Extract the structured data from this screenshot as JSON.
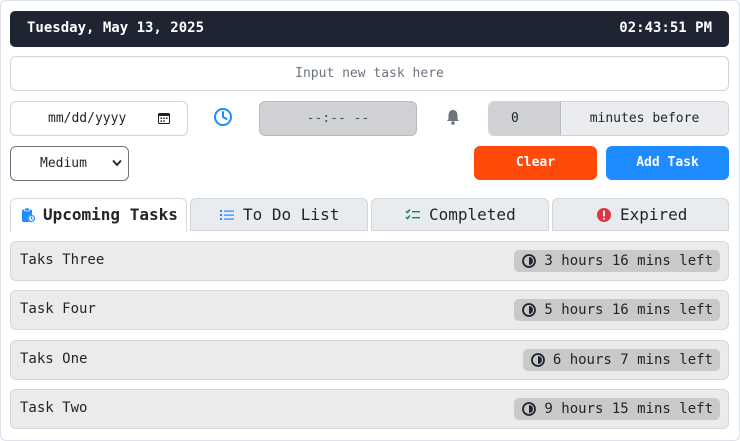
{
  "header": {
    "date": "Tuesday, May 13, 2025",
    "time": "02:43:51 PM"
  },
  "form": {
    "task_placeholder": "Input new task here",
    "date_placeholder": "mm/dd/yyyy",
    "time_placeholder": "--:-- --",
    "reminder_minutes": "0",
    "reminder_label": "minutes before",
    "priority_selected": "Medium",
    "clear_label": "Clear",
    "add_label": "Add Task"
  },
  "tabs": [
    {
      "label": "Upcoming Tasks",
      "icon": "clipboard-clock-icon",
      "active": true
    },
    {
      "label": "To Do List",
      "icon": "list-icon",
      "active": false
    },
    {
      "label": "Completed",
      "icon": "checklist-icon",
      "active": false
    },
    {
      "label": "Expired",
      "icon": "exclamation-circle-icon",
      "active": false
    }
  ],
  "tasks": [
    {
      "name": "Taks Three",
      "remaining": "3 hours 16 mins left"
    },
    {
      "name": "Task Four",
      "remaining": "5 hours 16 mins left"
    },
    {
      "name": "Taks One",
      "remaining": "6 hours 7 mins left"
    },
    {
      "name": "Task Two",
      "remaining": "9 hours 15 mins left"
    }
  ],
  "colors": {
    "header_bg": "#1f2433",
    "clear_button": "#ff4a0a",
    "add_button": "#1e8cff",
    "clock_icon": "#1e8cff",
    "completed_icon": "#198754",
    "expired_icon": "#dc3545"
  }
}
